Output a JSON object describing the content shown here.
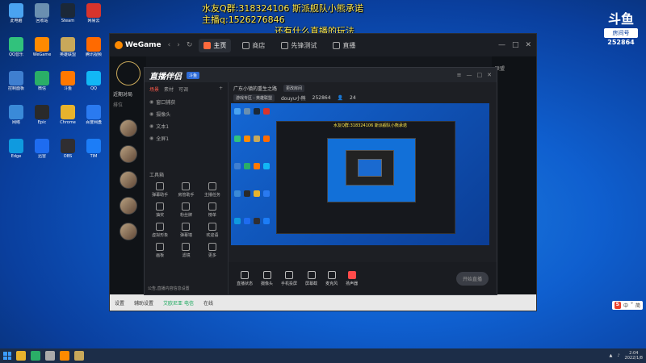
{
  "overlay": {
    "line1": "水友Q群:318324106 斯派舰队小熊承诺",
    "line2": "主播q:1526276846",
    "line3": "还有什么直播的玩法"
  },
  "douyu": {
    "brand": "斗鱼",
    "room_label": "房间号",
    "room_number": "252864"
  },
  "wegame": {
    "logo": "WeGame",
    "tabs": [
      "主页",
      "商店",
      "先锋测试",
      "直播"
    ],
    "left_nearby": "近期对局",
    "left_tab": "排位",
    "right_note": "联盟",
    "bottom": {
      "left": "设置",
      "mid": "辅助设置",
      "green": "艾欧尼亚 电信",
      "right": "在线"
    },
    "brand_color": "#ff8a00"
  },
  "zbbl": {
    "brand": "直播伴侣",
    "badge": "斗鱼",
    "side_tabs": [
      "场景",
      "素材",
      "可调"
    ],
    "sources": [
      "窗口捕获",
      "摄像头",
      "文本1",
      "全屏1"
    ],
    "tools_header": "工具箱",
    "tools": [
      "弹幕助手",
      "房管助手",
      "主播任务",
      "抽奖",
      "粉丝牌",
      "榜单",
      "虚拟形象",
      "弹幕墙",
      "欢迎语",
      "画板",
      "滤镜",
      "更多"
    ],
    "footer": "公告,直播内容信息设置",
    "header_title": "广东小镇的重生之路",
    "header_edit": "更改房间",
    "header_tags": [
      "游戏专区 - 英雄联盟",
      "douyu小熊",
      "252864"
    ],
    "viewers": "24",
    "bar_buttons": [
      "直播状态",
      "摄像头",
      "手机投屏",
      "屏幕截",
      "麦克风",
      "扬声器"
    ],
    "live_label": "开始直播"
  },
  "taskbar": {
    "time": "2:04",
    "date": "2022/1/8"
  },
  "sogou": {
    "s": "S",
    "items": [
      "中",
      "°",
      "简"
    ]
  },
  "desktop": [
    {
      "label": "此电脑",
      "color": "#4aa3f0"
    },
    {
      "label": "回收站",
      "color": "#6a8fb0"
    },
    {
      "label": "Steam",
      "color": "#1b2838"
    },
    {
      "label": "网易云",
      "color": "#d8342c"
    },
    {
      "label": "QQ音乐",
      "color": "#31c27c"
    },
    {
      "label": "WeGame",
      "color": "#ff8a00"
    },
    {
      "label": "英雄联盟",
      "color": "#c8a85a"
    },
    {
      "label": "腾讯视频",
      "color": "#ff6a00"
    },
    {
      "label": "控制面板",
      "color": "#3f7fd0"
    },
    {
      "label": "微信",
      "color": "#2aae67"
    },
    {
      "label": "斗鱼",
      "color": "#ff7800"
    },
    {
      "label": "QQ",
      "color": "#12b7f5"
    },
    {
      "label": "网络",
      "color": "#3a8ad8"
    },
    {
      "label": "Epic",
      "color": "#2a2a2a"
    },
    {
      "label": "Chrome",
      "color": "#e8b32c"
    },
    {
      "label": "百度网盘",
      "color": "#2a7af0"
    },
    {
      "label": "Edge",
      "color": "#0f9adf"
    },
    {
      "label": "迅雷",
      "color": "#1e6cf0"
    },
    {
      "label": "OBS",
      "color": "#302e31"
    },
    {
      "label": "TIM",
      "color": "#1c7df7"
    }
  ]
}
